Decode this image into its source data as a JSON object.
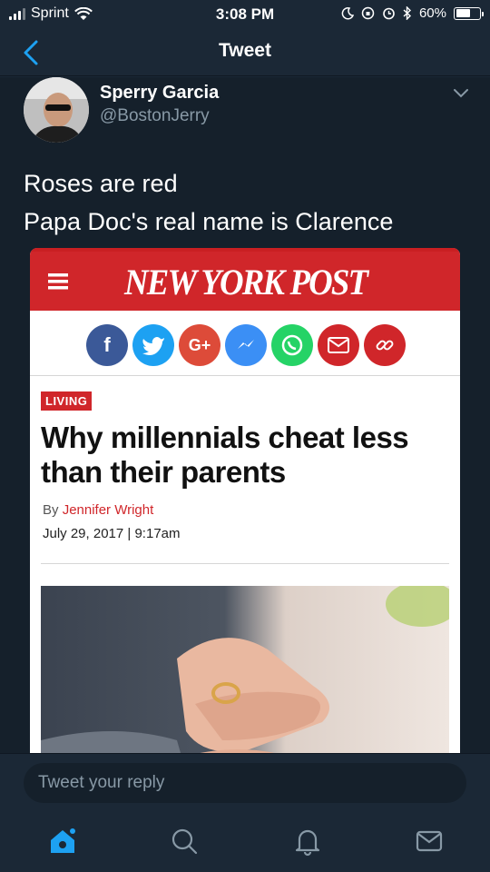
{
  "status": {
    "carrier": "Sprint",
    "time": "3:08 PM",
    "battery": "60%",
    "battery_level": 0.6
  },
  "nav": {
    "title": "Tweet"
  },
  "tweet": {
    "display_name": "Sperry Garcia",
    "handle": "@BostonJerry",
    "lines": [
      "Roses are red",
      "Papa Doc's real name is Clarence"
    ]
  },
  "article": {
    "publication": "NEW YORK POST",
    "section": "LIVING",
    "headline": "Why millennials cheat less than their parents",
    "byline_prefix": "By ",
    "author": "Jennifer Wright",
    "date": "July 29, 2017 | 9:17am",
    "share_buttons": [
      {
        "icon": "facebook-icon",
        "label": "f",
        "color": "#3b5998"
      },
      {
        "icon": "twitter-icon",
        "label": "",
        "color": "#1da1f2"
      },
      {
        "icon": "google-plus-icon",
        "label": "G+",
        "color": "#dd4b39"
      },
      {
        "icon": "messenger-icon",
        "label": "",
        "color": "#3b8ff5"
      },
      {
        "icon": "whatsapp-icon",
        "label": "",
        "color": "#25d366"
      },
      {
        "icon": "email-icon",
        "label": "",
        "color": "#d0262a"
      },
      {
        "icon": "link-icon",
        "label": "",
        "color": "#d0262a"
      }
    ]
  },
  "reply": {
    "placeholder": "Tweet your reply"
  },
  "tabs": [
    {
      "icon": "home-icon",
      "active": true
    },
    {
      "icon": "search-icon",
      "active": false
    },
    {
      "icon": "notifications-icon",
      "active": false
    },
    {
      "icon": "messages-icon",
      "active": false
    }
  ],
  "colors": {
    "accent": "#1da1f2",
    "background": "#15202b",
    "bar": "#1b2836",
    "post_red": "#d0262a",
    "muted_text": "#8899a6"
  }
}
